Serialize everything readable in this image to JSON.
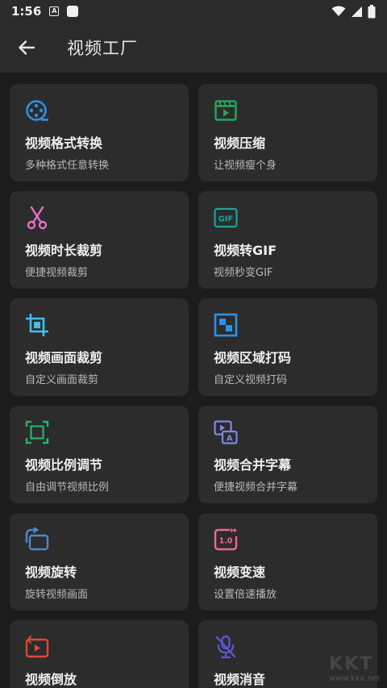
{
  "status": {
    "time": "1:56",
    "a_glyph": "A"
  },
  "header": {
    "title": "视频工厂"
  },
  "cards": [
    {
      "name": "视频格式转换",
      "desc": "多种格式任意转换",
      "icon": "film-reel-icon",
      "color": "#2f8fe8"
    },
    {
      "name": "视频压缩",
      "desc": "让视频瘦个身",
      "icon": "video-compress-icon",
      "color": "#24a65a"
    },
    {
      "name": "视频时长裁剪",
      "desc": "便捷视频裁剪",
      "icon": "scissors-icon",
      "color": "#e86fc6"
    },
    {
      "name": "视频转GIF",
      "desc": "视频秒变GIF",
      "icon": "gif-icon",
      "color": "#1aa39a",
      "icon_text": "GIF"
    },
    {
      "name": "视频画面裁剪",
      "desc": "自定义画面裁剪",
      "icon": "crop-icon",
      "color": "#3fc0ee"
    },
    {
      "name": "视频区域打码",
      "desc": "自定义视频打码",
      "icon": "mosaic-icon",
      "color": "#2f8fe8"
    },
    {
      "name": "视频比例调节",
      "desc": "自由调节视频比例",
      "icon": "aspect-ratio-icon",
      "color": "#26b36b"
    },
    {
      "name": "视频合并字幕",
      "desc": "便捷视频合并字幕",
      "icon": "subtitle-icon",
      "color": "#7f86e6",
      "icon_text": "A"
    },
    {
      "name": "视频旋转",
      "desc": "旋转视频画面",
      "icon": "rotate-icon",
      "color": "#4f86c6"
    },
    {
      "name": "视频变速",
      "desc": "设置倍速播放",
      "icon": "speed-icon",
      "color": "#f06690",
      "icon_text": "1.0"
    },
    {
      "name": "视频倒放",
      "desc": "",
      "icon": "reverse-play-icon",
      "color": "#e0463c"
    },
    {
      "name": "视频消音",
      "desc": "",
      "icon": "mute-mic-icon",
      "color": "#5a57d6"
    }
  ],
  "watermark": {
    "big": "KKT",
    "small": "www.kkx.net"
  }
}
